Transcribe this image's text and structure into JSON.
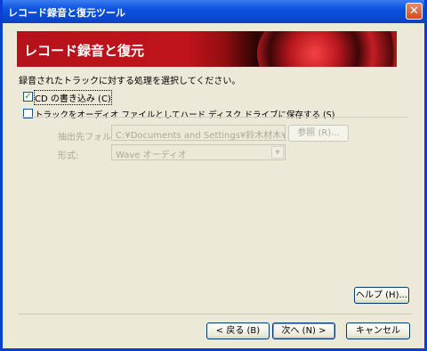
{
  "window": {
    "title": "レコード録音と復元ツール",
    "close_glyph": "✕"
  },
  "banner": {
    "title": "レコード録音と復元"
  },
  "instruction": "録音されたトラックに対する処理を選択してください。",
  "options": {
    "write_cd": {
      "checked": true,
      "check_glyph": "✓",
      "label": "CD の書き込み (C)"
    },
    "save_to_disk": {
      "checked": false,
      "label": "トラックをオーディオ ファイルとしてハード ディスク ドライブに保存する (S)"
    }
  },
  "save_settings": {
    "folder_label": "抽出先フォルダ (F):",
    "folder_value": "C:¥Documents and Settings¥鈴木材木¥My",
    "browse_label": "参照 (R)...",
    "format_label": "形式:",
    "format_value": "Wave オーディオ",
    "dropdown_glyph": "▼"
  },
  "buttons": {
    "help": "ヘルプ (H)...",
    "back": "< 戻る (B)",
    "next": "次へ (N) >",
    "cancel": "キャンセル"
  }
}
